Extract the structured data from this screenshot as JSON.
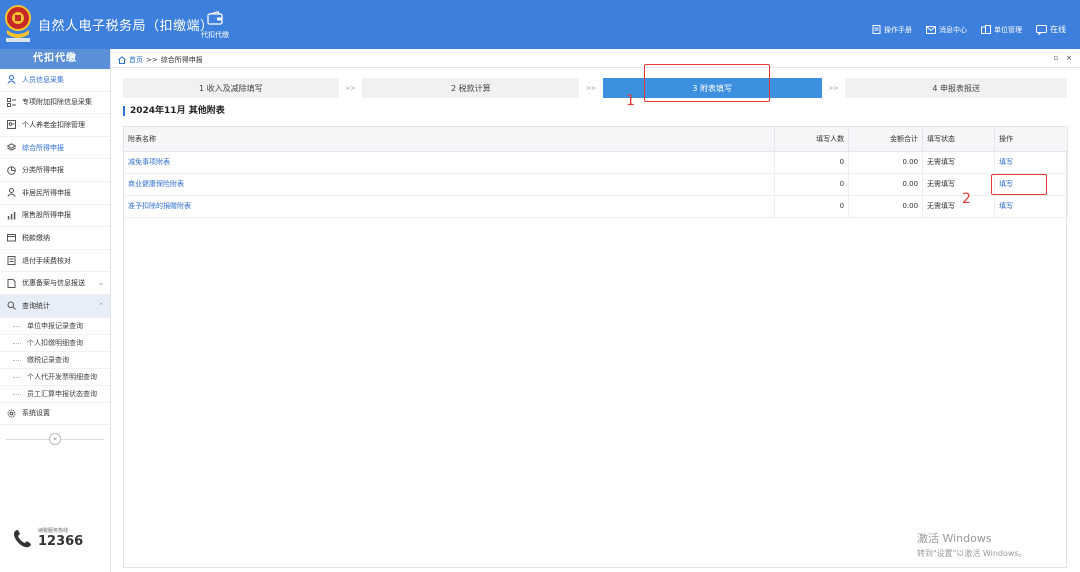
{
  "header": {
    "app_title": "自然人电子税务局（扣缴端）",
    "module_label": "代扣代缴",
    "links": [
      {
        "label": "操作手册",
        "icon": "manual-icon"
      },
      {
        "label": "消息中心",
        "icon": "mail-icon"
      },
      {
        "label": "单位管理",
        "icon": "building-icon"
      },
      {
        "label": "在线",
        "icon": "chat-icon"
      }
    ]
  },
  "sidebar": {
    "title": "代扣代缴",
    "items": [
      {
        "label": "人员信息采集",
        "icon": "person-icon"
      },
      {
        "label": "专项附加扣除信息采集",
        "icon": "list-icon"
      },
      {
        "label": "个人养老金扣除管理",
        "icon": "card-icon"
      },
      {
        "label": "综合所得申报",
        "icon": "layers-icon"
      },
      {
        "label": "分类所得申报",
        "icon": "pie-icon"
      },
      {
        "label": "非居民所得申报",
        "icon": "person-icon"
      },
      {
        "label": "限售股所得申报",
        "icon": "chart-icon"
      },
      {
        "label": "税款缴纳",
        "icon": "wallet-icon"
      },
      {
        "label": "退付手续费核对",
        "icon": "receipt-icon"
      },
      {
        "label": "优惠备案与信息报送",
        "icon": "doc-icon"
      },
      {
        "label": "查询统计",
        "icon": "search-icon"
      }
    ],
    "sub_items": [
      "单位申报记录查询",
      "个人扣缴明细查询",
      "缴税记录查询",
      "个人代开发票明细查询",
      "员工汇算申报状态查询"
    ],
    "settings_label": "系统设置",
    "hotline_label": "纳税服务热线",
    "hotline_number": "12366"
  },
  "breadcrumb": {
    "home": "首页",
    "separator": ">>",
    "current": "综合所得申报"
  },
  "steps": [
    {
      "label": "1 收入及减除填写"
    },
    {
      "label": "2 税款计算"
    },
    {
      "label": "3 附表填写"
    },
    {
      "label": "4 申报表报送"
    }
  ],
  "step_separator": ">>",
  "section_title": "2024年11月  其他附表",
  "table": {
    "columns": [
      "附表名称",
      "填写人数",
      "金额合计",
      "填写状态",
      "操作"
    ],
    "rows": [
      {
        "name": "减免事项附表",
        "count": "0",
        "amount": "0.00",
        "status": "无需填写",
        "action": "填写"
      },
      {
        "name": "商业健康保险附表",
        "count": "0",
        "amount": "0.00",
        "status": "无需填写",
        "action": "填写"
      },
      {
        "name": "准予扣除的捐赠附表",
        "count": "0",
        "amount": "0.00",
        "status": "无需填写",
        "action": "填写"
      }
    ]
  },
  "annotations": [
    {
      "number": "1"
    },
    {
      "number": "2"
    }
  ],
  "watermark": {
    "line1": "激活 Windows",
    "line2": "转到\"设置\"以激活 Windows。"
  },
  "colors": {
    "header_bg": "#3c7fdc",
    "active_step": "#3d8fe0",
    "link": "#2f6fd0",
    "annotation": "#e53935"
  }
}
